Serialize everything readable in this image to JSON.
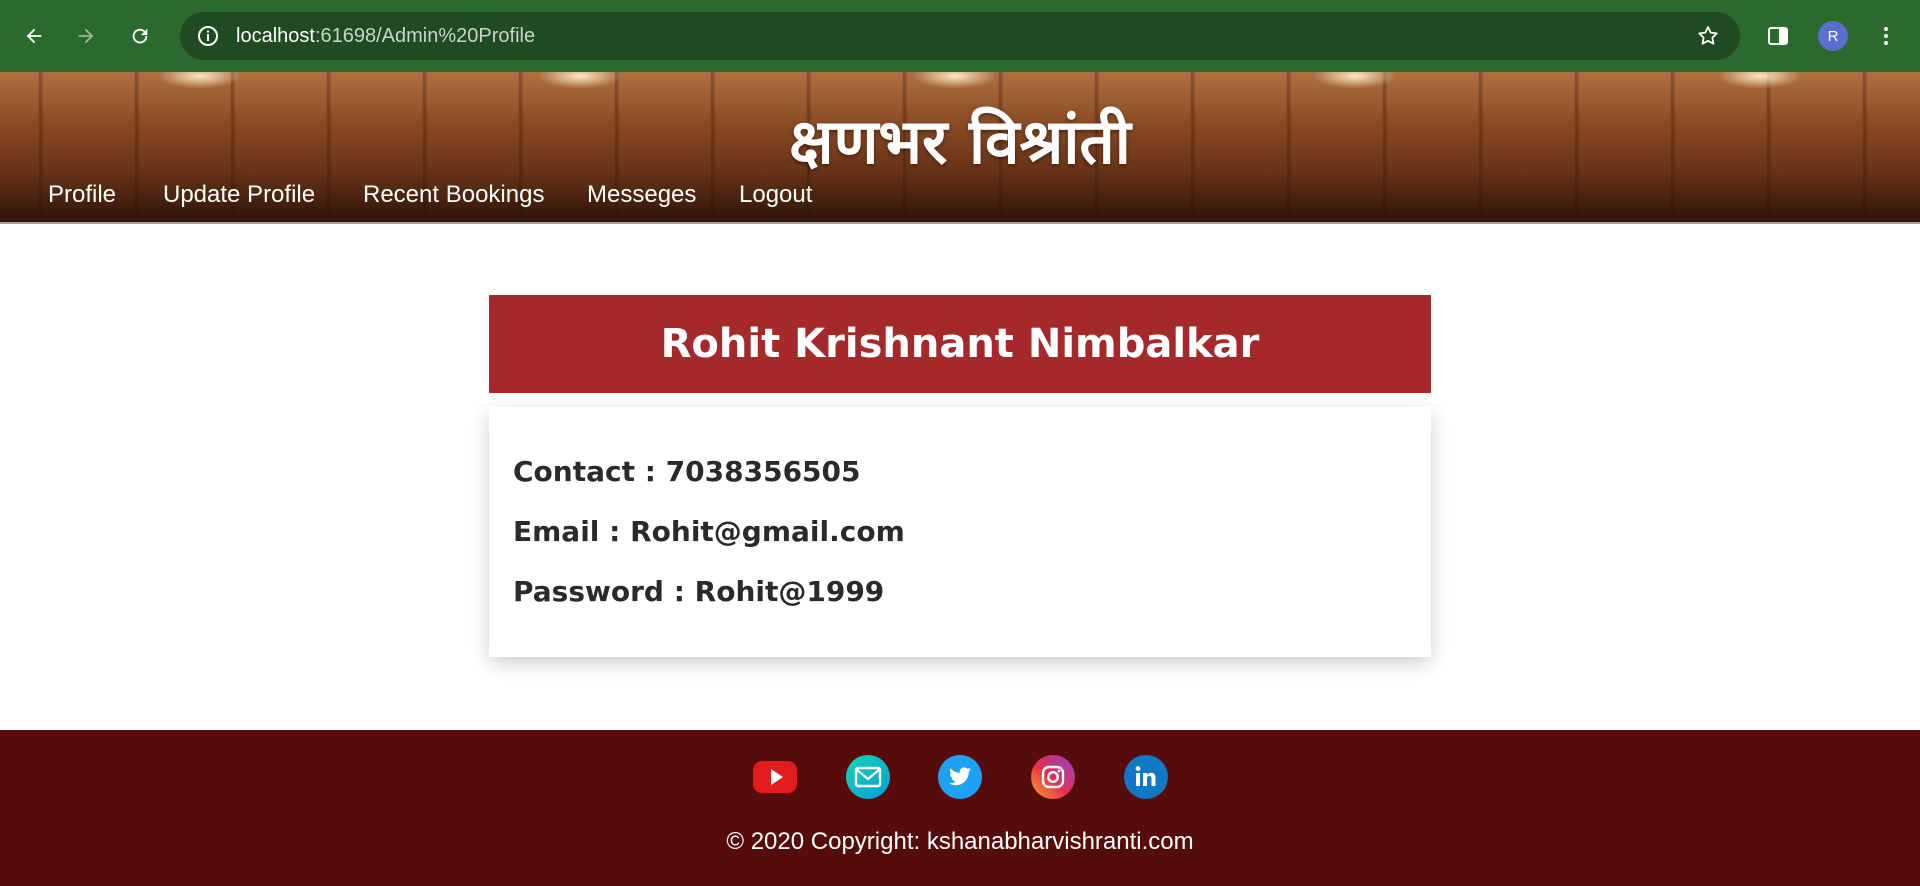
{
  "browser": {
    "url_host": "localhost",
    "url_path": ":61698/Admin%20Profile",
    "profile_initial": "R",
    "icons": [
      "back-arrow-icon",
      "forward-arrow-icon",
      "reload-icon",
      "info-icon",
      "star-icon",
      "side-panel-icon",
      "kebab-menu-icon"
    ]
  },
  "site": {
    "title": "क्षणभर विश्रांती",
    "nav": [
      "Profile",
      "Update Profile",
      "Recent Bookings",
      "Messeges",
      "Logout"
    ]
  },
  "profile": {
    "name": "Rohit Krishnant Nimbalkar",
    "contact": "Contact : 7038356505",
    "email": "Email : Rohit@gmail.com",
    "password": "Password : Rohit@1999"
  },
  "footer": {
    "social_icons": [
      "youtube-icon",
      "email-icon",
      "twitter-icon",
      "instagram-icon",
      "linkedin-icon"
    ],
    "copyright": "© 2020 Copyright: kshanabharvishranti.com"
  },
  "colors": {
    "browser_bar": "#2a6a2e",
    "card_header": "#a5292b",
    "footer": "#570c0c"
  }
}
